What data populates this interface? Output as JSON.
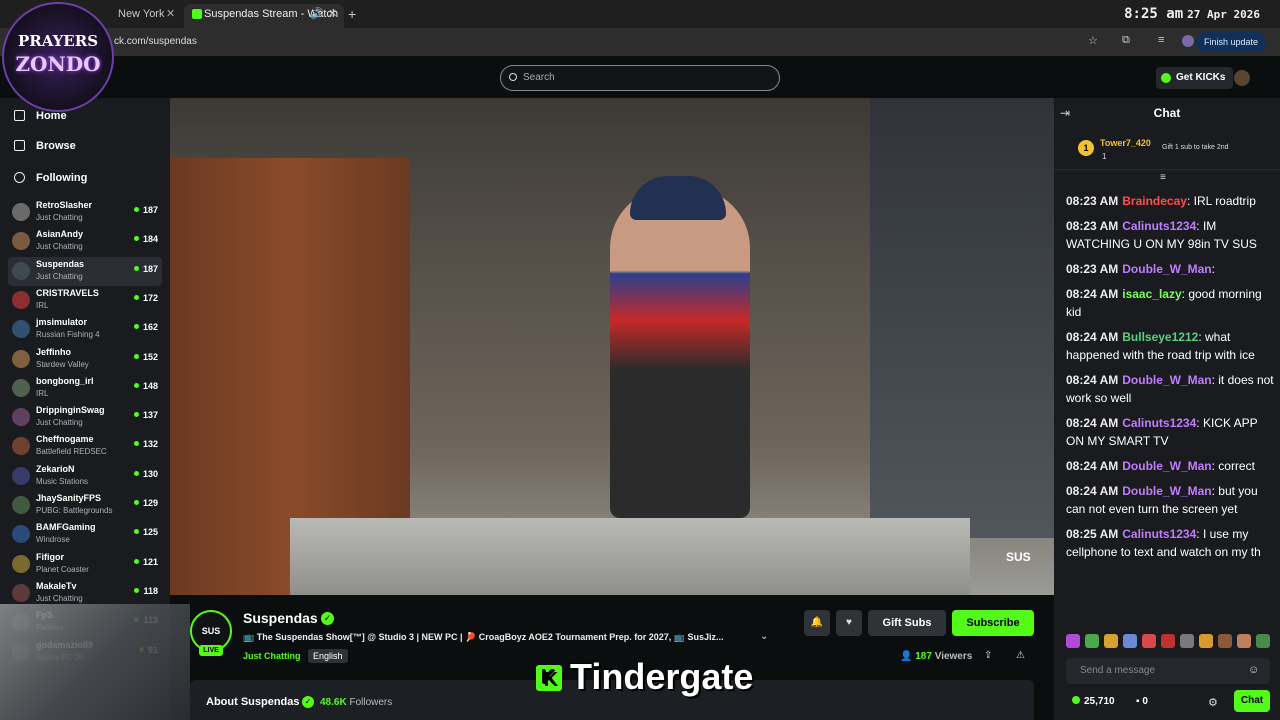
{
  "browser": {
    "tab_inactive": "New York",
    "tab_active": "Suspendas Stream - Watch",
    "url": "ck.com/suspendas",
    "finish_update": "Finish update",
    "clock_time": "8:25 am",
    "clock_date": "27 Apr 2026"
  },
  "logo": {
    "line1": "PRAYERS",
    "line2": "ZONDO"
  },
  "topbar": {
    "search_placeholder": "Search",
    "get_kicks": "Get KICKs"
  },
  "sidebar": {
    "nav": [
      {
        "label": "Home",
        "icon": "home-icon"
      },
      {
        "label": "Browse",
        "icon": "browse-icon"
      },
      {
        "label": "Following",
        "icon": "heart-icon"
      }
    ],
    "channels": [
      {
        "name": "RetroSlasher",
        "category": "Just Chatting",
        "viewers": "187",
        "color": "#6a6a6a"
      },
      {
        "name": "AsianAndy",
        "category": "Just Chatting",
        "viewers": "184",
        "color": "#7a5a40"
      },
      {
        "name": "Suspendas",
        "category": "Just Chatting",
        "viewers": "187",
        "color": "#404850",
        "selected": true
      },
      {
        "name": "CRISTRAVELS",
        "category": "IRL",
        "viewers": "172",
        "color": "#8a3030"
      },
      {
        "name": "jmsimulator",
        "category": "Russian Fishing 4",
        "viewers": "162",
        "color": "#305070"
      },
      {
        "name": "Jeffinho",
        "category": "Stardew Valley",
        "viewers": "152",
        "color": "#806040"
      },
      {
        "name": "bongbong_irl",
        "category": "IRL",
        "viewers": "148",
        "color": "#506050"
      },
      {
        "name": "DrippinginSwag",
        "category": "Just Chatting",
        "viewers": "137",
        "color": "#604060"
      },
      {
        "name": "Cheffnogame",
        "category": "Battlefield REDSEC",
        "viewers": "132",
        "color": "#704030"
      },
      {
        "name": "ZekarioN",
        "category": "Music Stations",
        "viewers": "130",
        "color": "#3a3a6a"
      },
      {
        "name": "JhaySanityFPS",
        "category": "PUBG: Battlegrounds",
        "viewers": "129",
        "color": "#405a40"
      },
      {
        "name": "BAMFGaming",
        "category": "Windrose",
        "viewers": "125",
        "color": "#2a4a7a"
      },
      {
        "name": "Fifigor",
        "category": "Planet Coaster",
        "viewers": "121",
        "color": "#7a6a30"
      },
      {
        "name": "MakaleTv",
        "category": "Just Chatting",
        "viewers": "118",
        "color": "#5a3a3a"
      },
      {
        "name": "FpS",
        "category": "Raiders",
        "viewers": "113",
        "color": "#3a5a5a"
      },
      {
        "name": "godamazio89",
        "category": "Sports FC 26",
        "viewers": "91",
        "color": "#4a4a4a"
      }
    ]
  },
  "video": {
    "watermark": "SUS"
  },
  "stream": {
    "channel_avatar": "SUS",
    "live": "LIVE",
    "channel_name": "Suspendas",
    "title": "📺 The Suspendas Show[™] @ Studio 3 | NEW PC | 🏓 CroagBoyz AOE2 Tournament Prep. for 2027, 📺 SusJiz...",
    "category": "Just Chatting",
    "language": "English",
    "gift_subs": "Gift Subs",
    "subscribe": "Subscribe",
    "viewers_count": "187",
    "viewers_label": "Viewers"
  },
  "about": {
    "title": "About Suspendas",
    "followers_count": "48.6K",
    "followers_label": "Followers"
  },
  "overlay": {
    "text": "Tindergate",
    "k": "K"
  },
  "chat": {
    "title": "Chat",
    "pinned": {
      "rank": "1",
      "user": "Tower7_420",
      "count": "1",
      "gift_text": "Gift 1 sub to take 2nd"
    },
    "messages": [
      {
        "time": "08:23 AM",
        "user": "Braindecay",
        "color": "#ff4d4d",
        "text": "IRL roadtrip"
      },
      {
        "time": "08:23 AM",
        "user": "Calinuts1234",
        "color": "#c27cff",
        "text": "IM WATCHING U ON MY 98in TV SUS"
      },
      {
        "time": "08:23 AM",
        "user": "Double_W_Man",
        "color": "#c27cff",
        "text": ""
      },
      {
        "time": "08:24 AM",
        "user": "isaac_lazy",
        "color": "#7cff5a",
        "text": "good morning kid"
      },
      {
        "time": "08:24 AM",
        "user": "Bullseye1212",
        "color": "#5ad17c",
        "text": "what happened with the road trip with ice"
      },
      {
        "time": "08:24 AM",
        "user": "Double_W_Man",
        "color": "#c27cff",
        "text": "it does not work so well"
      },
      {
        "time": "08:24 AM",
        "user": "Calinuts1234",
        "color": "#c27cff",
        "text": "KICK APP ON MY SMART TV"
      },
      {
        "time": "08:24 AM",
        "user": "Double_W_Man",
        "color": "#c27cff",
        "text": "correct"
      },
      {
        "time": "08:24 AM",
        "user": "Double_W_Man",
        "color": "#c27cff",
        "text": "but you can not even turn the screen yet"
      },
      {
        "time": "08:25 AM",
        "user": "Calinuts1234",
        "color": "#c27cff",
        "text": "I use my cellphone to text and watch on my th"
      }
    ],
    "input_placeholder": "Send a message",
    "kicks_balance": "25,710",
    "points": "0",
    "send": "Chat"
  }
}
